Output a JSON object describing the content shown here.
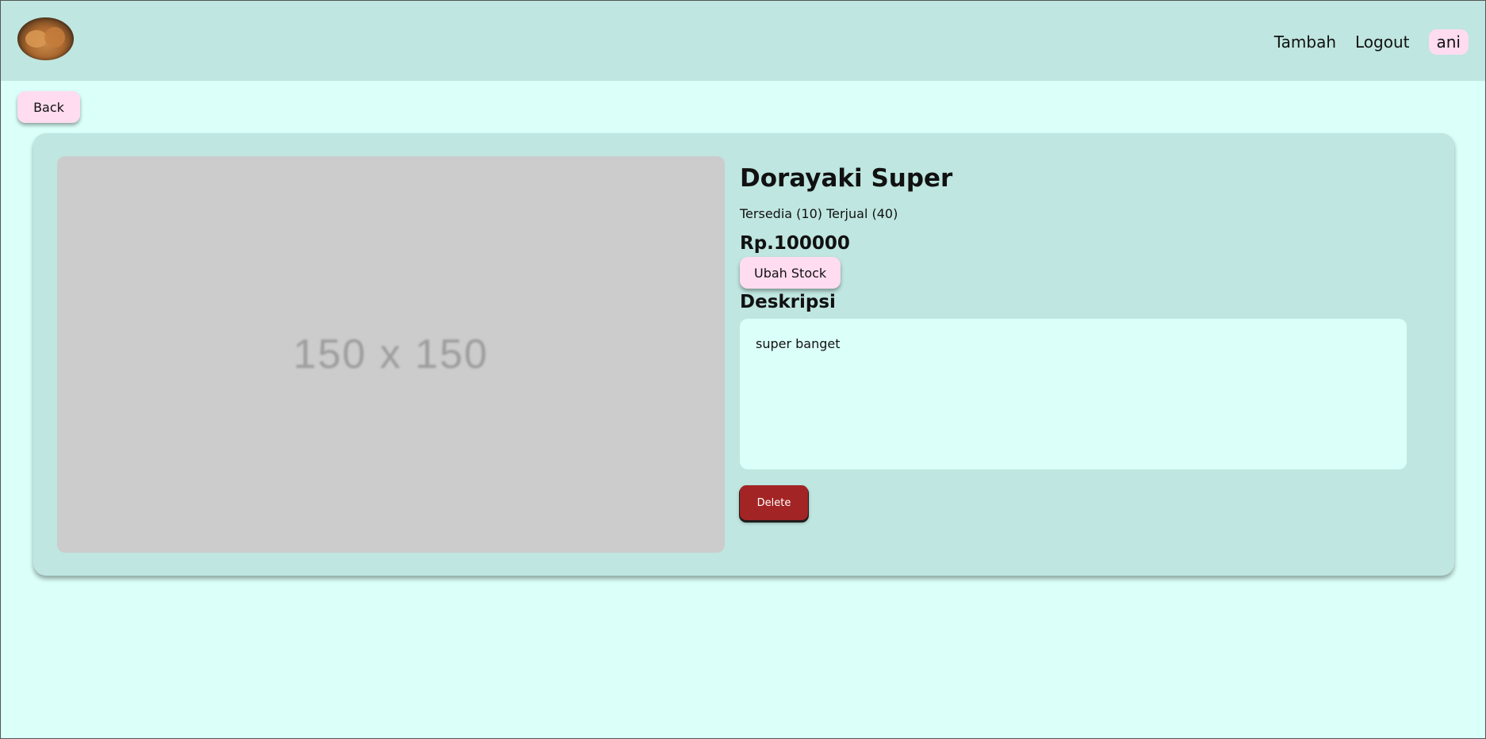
{
  "nav": {
    "logo_icon": "dorayaki-logo-icon",
    "links": [
      "Tambah",
      "Logout"
    ],
    "user": "ani"
  },
  "back_label": "Back",
  "product": {
    "image_placeholder": "150 x 150",
    "title": "Dorayaki Super",
    "stock_text": "Tersedia (10) Terjual (40)",
    "price": "Rp.100000",
    "change_stock_label": "Ubah Stock",
    "description_heading": "Deskripsi",
    "description": "super banget",
    "delete_label": "Delete"
  },
  "colors": {
    "background": "#dbfff9",
    "navbar": "#bfe6e0",
    "card": "#bfe6e0",
    "pink_button": "#ffdcf0",
    "delete_button": "#a32424",
    "image_placeholder": "#cccccc"
  }
}
